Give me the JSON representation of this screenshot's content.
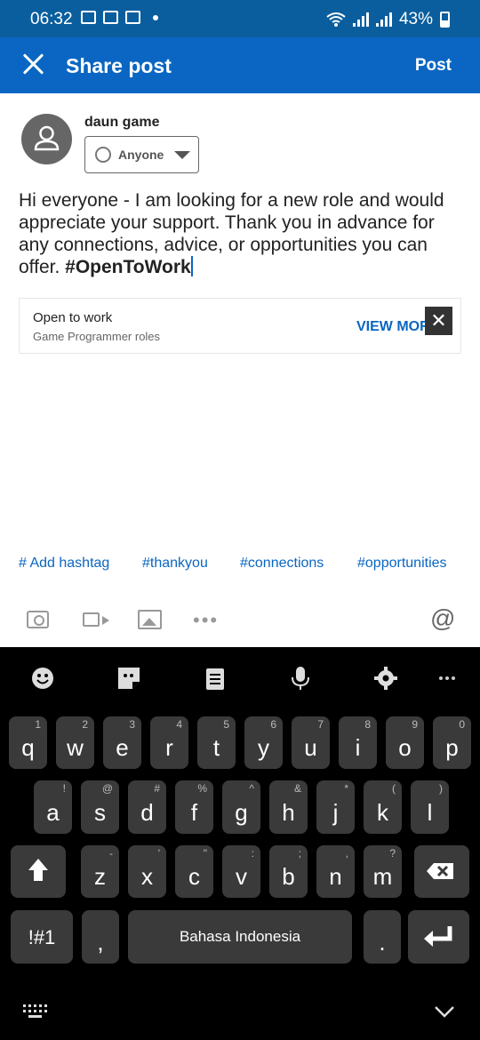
{
  "status": {
    "time": "06:32",
    "battery": "43%"
  },
  "appbar": {
    "title": "Share post",
    "post_label": "Post"
  },
  "author": {
    "name": "daun game",
    "audience": "Anyone"
  },
  "composer": {
    "text": "Hi everyone - I am looking for a new role and would appreciate your support. Thank you in advance for any connections, advice, or opportunities you can offer. ",
    "hashtag": "#OpenToWork"
  },
  "card": {
    "title": "Open to work",
    "subtitle": "Game Programmer roles",
    "action": "VIEW MORE",
    "close": "✕"
  },
  "hashtags": [
    "# Add hashtag",
    "#thankyou",
    "#connections",
    "#opportunities"
  ],
  "keyboard": {
    "row1": [
      [
        "q",
        "1"
      ],
      [
        "w",
        "2"
      ],
      [
        "e",
        "3"
      ],
      [
        "r",
        "4"
      ],
      [
        "t",
        "5"
      ],
      [
        "y",
        "6"
      ],
      [
        "u",
        "7"
      ],
      [
        "i",
        "8"
      ],
      [
        "o",
        "9"
      ],
      [
        "p",
        "0"
      ]
    ],
    "row2": [
      [
        "a",
        "!"
      ],
      [
        "s",
        "@"
      ],
      [
        "d",
        "#"
      ],
      [
        "f",
        "%"
      ],
      [
        "g",
        "^"
      ],
      [
        "h",
        "&"
      ],
      [
        "j",
        "*"
      ],
      [
        "k",
        "("
      ],
      [
        "l",
        ")"
      ]
    ],
    "row3": [
      [
        "z",
        "-"
      ],
      [
        "x",
        "'"
      ],
      [
        "c",
        "\""
      ],
      [
        "v",
        ":"
      ],
      [
        "b",
        ";"
      ],
      [
        "n",
        ","
      ],
      [
        "m",
        "?"
      ]
    ],
    "symbols_label": "!#1",
    "comma": ",",
    "space_label": "Bahasa Indonesia",
    "period": "."
  }
}
